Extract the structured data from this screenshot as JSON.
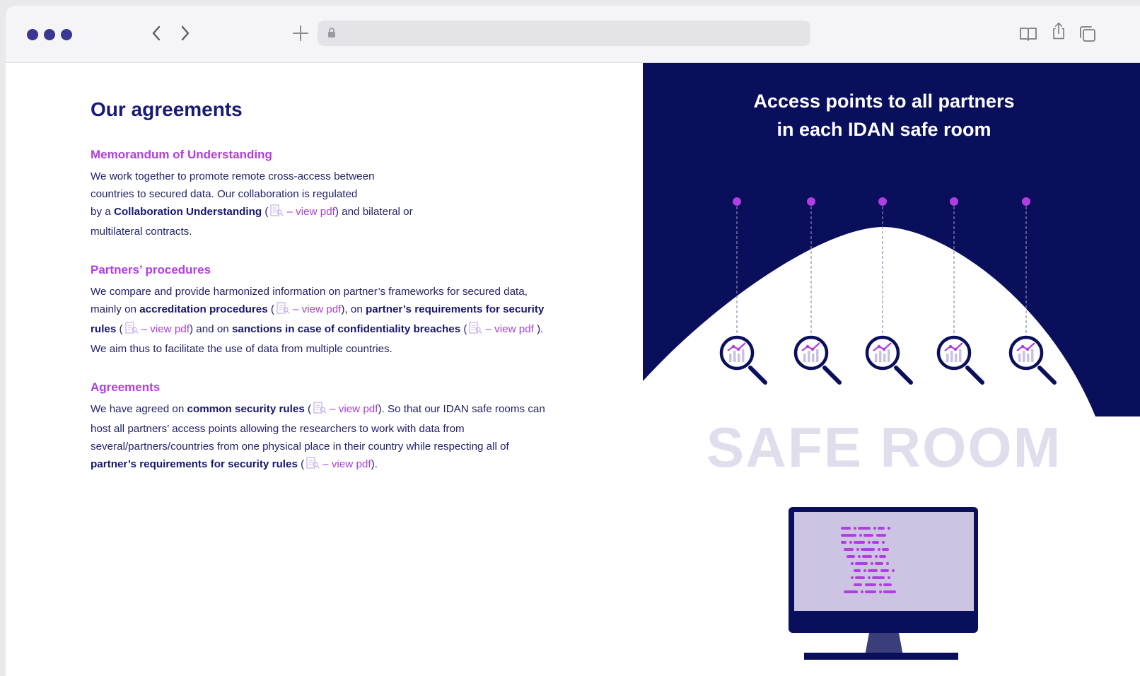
{
  "browser": {
    "back_glyph": "‹",
    "forward_glyph": "›",
    "new_tab_glyph": "+",
    "url": "",
    "icons": [
      "reader-icon",
      "share-icon",
      "tabs-icon",
      "lock-icon"
    ]
  },
  "page": {
    "title": "Our agreements",
    "sections": [
      {
        "heading": "Memorandum of Understanding",
        "parts": [
          {
            "t": "We work together to promote remote cross-access between"
          },
          {
            "br": true
          },
          {
            "t": "countries to secured data. Our collaboration is regulated"
          },
          {
            "br": true
          },
          {
            "t": "by a "
          },
          {
            "b": "Collaboration Understanding"
          },
          {
            "t": " ("
          },
          {
            "pdf": "– view pdf"
          },
          {
            "t": ") and bilateral or"
          },
          {
            "br": true
          },
          {
            "t": "multilateral contracts."
          }
        ]
      },
      {
        "heading": "Partners’ procedures",
        "parts": [
          {
            "t": "We compare and provide harmonized information on partner’s frameworks for secured data,"
          },
          {
            "br": true
          },
          {
            "t": "mainly on "
          },
          {
            "b": "accreditation procedures"
          },
          {
            "t": " ("
          },
          {
            "pdf": "– view pdf"
          },
          {
            "t": "), on "
          },
          {
            "b": "partner’s requirements for security"
          },
          {
            "br": true
          },
          {
            "b": "rules"
          },
          {
            "t": " ("
          },
          {
            "pdf": "– view pdf"
          },
          {
            "t": ") and on "
          },
          {
            "b": "sanctions in case of confidentiality breaches"
          },
          {
            "t": " ("
          },
          {
            "pdf": "– view pdf"
          },
          {
            "t": " )."
          },
          {
            "br": true
          },
          {
            "t": "We aim thus to facilitate the use of data from multiple countries."
          }
        ]
      },
      {
        "heading": "Agreements",
        "parts": [
          {
            "t": "We have agreed on "
          },
          {
            "b": "common security rules"
          },
          {
            "t": " ("
          },
          {
            "pdf": "– view pdf"
          },
          {
            "t": "). So that our IDAN safe rooms can"
          },
          {
            "br": true
          },
          {
            "t": "host all partners’ access points allowing the researchers to work with data from"
          },
          {
            "br": true
          },
          {
            "t": "several/partners/countries from one physical place in their country while respecting all of"
          },
          {
            "br": true
          },
          {
            "b": "partner’s requirements for security rules"
          },
          {
            "t": " ("
          },
          {
            "pdf": "– view pdf"
          },
          {
            "t": ")."
          }
        ]
      }
    ]
  },
  "illustration": {
    "title_line1": "Access points to all partners",
    "title_line2": "in each IDAN safe room",
    "safe_room_label": "SAFE ROOM",
    "access_point_count": 5,
    "colors": {
      "navy": "#0a0f5c",
      "accent": "#b13ee0",
      "heading": "#191979",
      "screen": "#cdc3e3",
      "safe_room_text": "#e0deec"
    }
  }
}
